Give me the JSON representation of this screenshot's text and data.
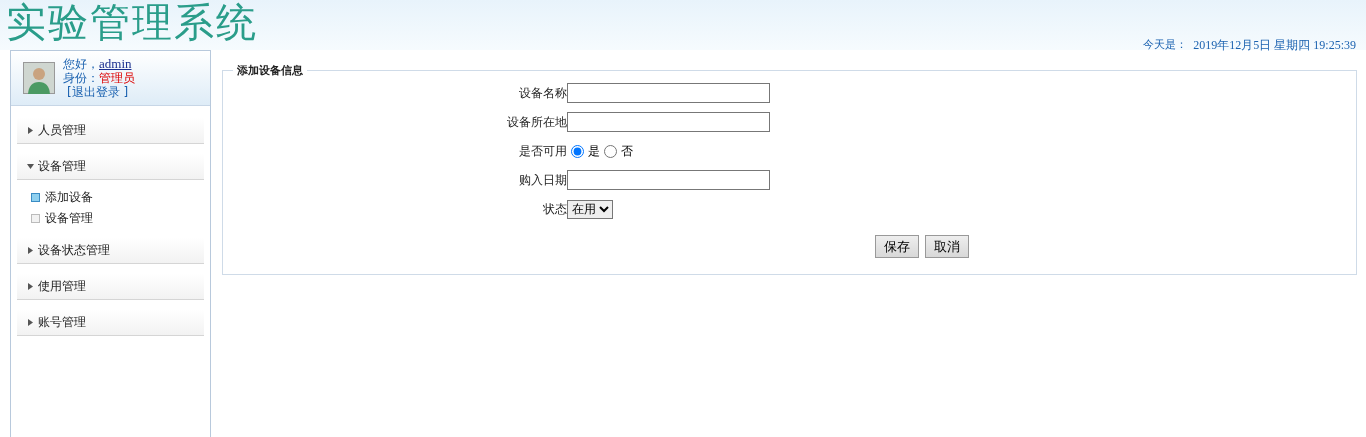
{
  "header": {
    "title": "实验管理系统",
    "date_label": "今天是：",
    "date_value": "2019年12月5日 星期四 19:25:39"
  },
  "user": {
    "greeting": "您好，",
    "username": "admin",
    "role_label": "身份：",
    "role": "管理员",
    "logout": "[退出登录 ]"
  },
  "menu": [
    {
      "label": "人员管理",
      "expanded": false
    },
    {
      "label": "设备管理",
      "expanded": true,
      "children": [
        {
          "label": "添加设备",
          "selected": true
        },
        {
          "label": "设备管理",
          "selected": false
        }
      ]
    },
    {
      "label": "设备状态管理",
      "expanded": false
    },
    {
      "label": "使用管理",
      "expanded": false
    },
    {
      "label": "账号管理",
      "expanded": false
    }
  ],
  "form": {
    "legend": "添加设备信息",
    "fields": [
      {
        "kind": "text",
        "label": "设备名称"
      },
      {
        "kind": "text",
        "label": "设备所在地"
      },
      {
        "kind": "radio",
        "label": "是否可用",
        "options": [
          {
            "label": "是",
            "selected": true
          },
          {
            "label": "否",
            "selected": false
          }
        ]
      },
      {
        "kind": "text",
        "label": "购入日期"
      },
      {
        "kind": "select",
        "label": "状态",
        "value": "在用"
      }
    ],
    "buttons": [
      "保存",
      "取消"
    ]
  }
}
